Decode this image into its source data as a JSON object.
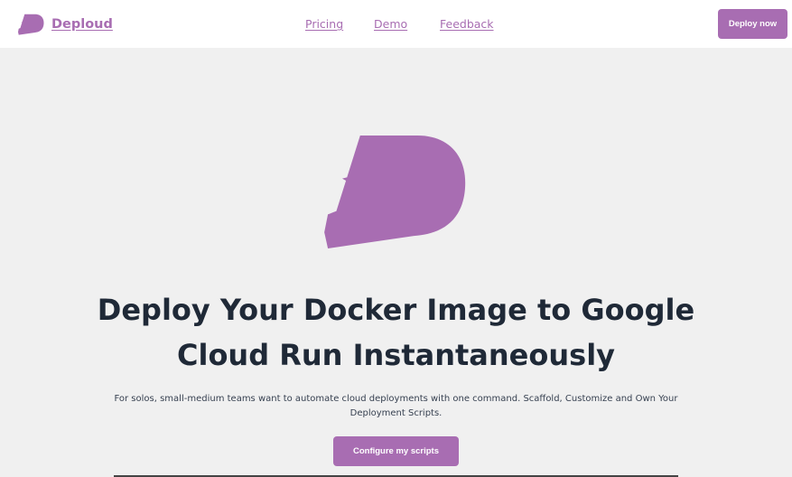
{
  "brand": {
    "name": "Deploud",
    "logo_icon": "rocket-d-logo-icon",
    "color": "#a86db2"
  },
  "nav": {
    "links": [
      {
        "label": "Pricing"
      },
      {
        "label": "Demo"
      },
      {
        "label": "Feedback"
      }
    ],
    "cta_label": "Deploy now"
  },
  "hero": {
    "logo_icon": "rocket-d-logo-icon",
    "title": "Deploy Your Docker Image to Google Cloud Run Instantaneously",
    "subtitle": "For solos, small-medium teams want to automate cloud deployments with one command. Scaffold, Customize and Own Your Deployment Scripts.",
    "cta_label": "Configure my scripts"
  },
  "colors": {
    "accent": "#a86db2",
    "background": "#f0f0f0",
    "navbar_background": "#ffffff",
    "heading_text": "#1f2937"
  }
}
